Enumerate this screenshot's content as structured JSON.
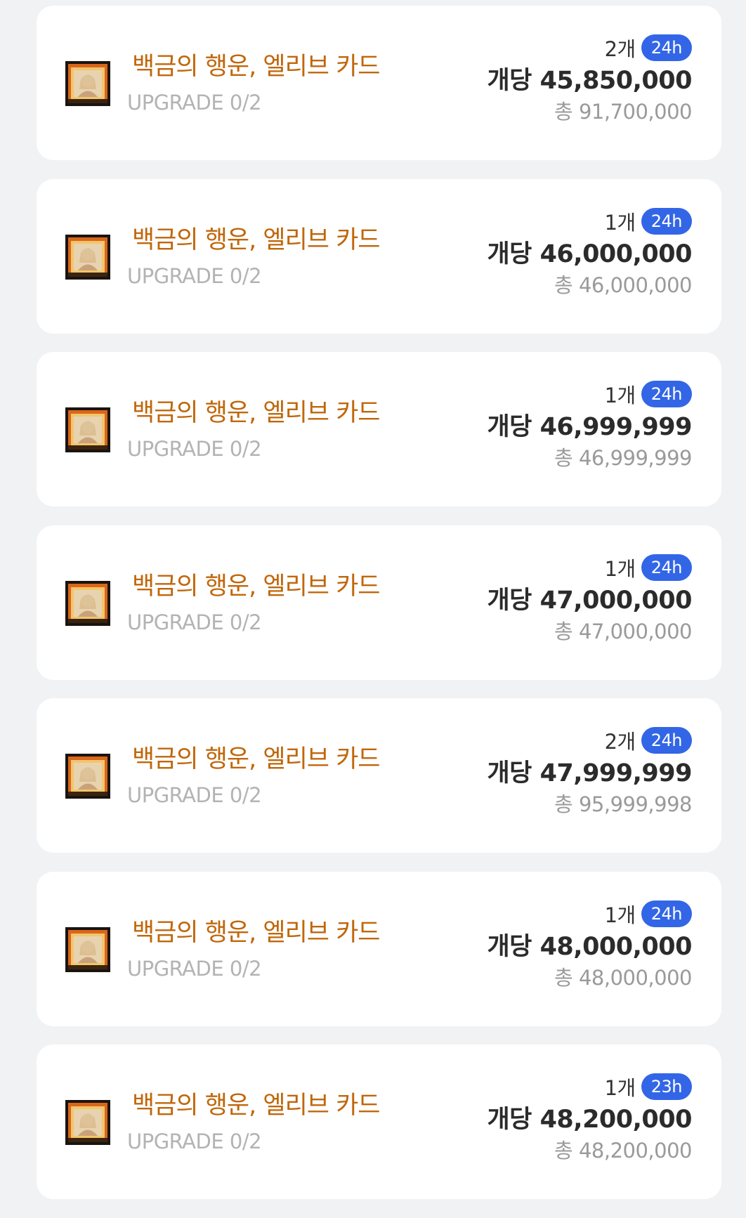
{
  "listings": [
    {
      "name": "백금의 행운, 엘리브 카드",
      "upgrade": "UPGRADE 0/2",
      "qty": "2개",
      "badge": "24h",
      "unit_price": "개당 45,850,000",
      "total": "총 91,700,000"
    },
    {
      "name": "백금의 행운, 엘리브 카드",
      "upgrade": "UPGRADE 0/2",
      "qty": "1개",
      "badge": "24h",
      "unit_price": "개당 46,000,000",
      "total": "총 46,000,000"
    },
    {
      "name": "백금의 행운, 엘리브 카드",
      "upgrade": "UPGRADE 0/2",
      "qty": "1개",
      "badge": "24h",
      "unit_price": "개당 46,999,999",
      "total": "총 46,999,999"
    },
    {
      "name": "백금의 행운, 엘리브 카드",
      "upgrade": "UPGRADE 0/2",
      "qty": "1개",
      "badge": "24h",
      "unit_price": "개당 47,000,000",
      "total": "총 47,000,000"
    },
    {
      "name": "백금의 행운, 엘리브 카드",
      "upgrade": "UPGRADE 0/2",
      "qty": "2개",
      "badge": "24h",
      "unit_price": "개당 47,999,999",
      "total": "총 95,999,998"
    },
    {
      "name": "백금의 행운, 엘리브 카드",
      "upgrade": "UPGRADE 0/2",
      "qty": "1개",
      "badge": "24h",
      "unit_price": "개당 48,000,000",
      "total": "총 48,000,000"
    },
    {
      "name": "백금의 행운, 엘리브 카드",
      "upgrade": "UPGRADE 0/2",
      "qty": "1개",
      "badge": "23h",
      "unit_price": "개당 48,200,000",
      "total": "총 48,200,000"
    }
  ],
  "colors": {
    "background": "#f1f2f4",
    "card": "#ffffff",
    "item_name": "#c0670b",
    "upgrade": "#b3b3b3",
    "badge": "#3366e6",
    "price": "#2b2b2b",
    "total": "#9a9a9a"
  },
  "icons": {
    "item": "card-item-icon"
  }
}
